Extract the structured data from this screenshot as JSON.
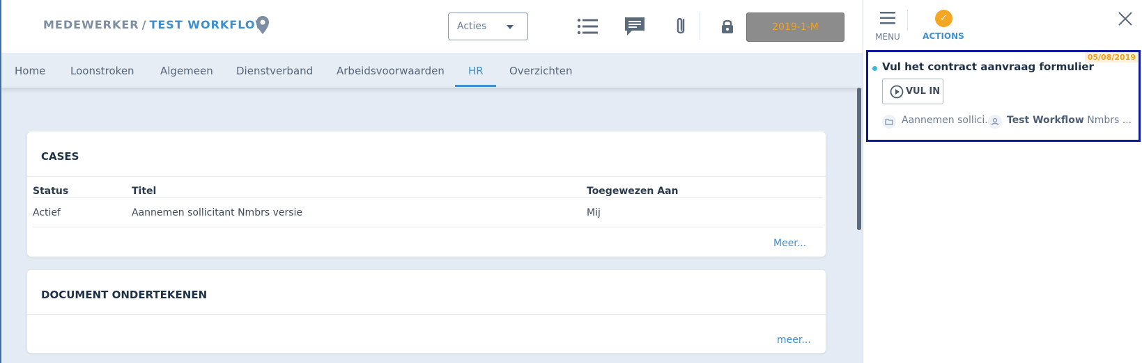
{
  "header": {
    "crumb_parent": "MEDEWERKER",
    "crumb_separator": "/",
    "crumb_current": "TEST WORKFLOW",
    "actions_dropdown": "Acties",
    "period_button": "2019-1-M"
  },
  "tabs": [
    {
      "label": "Home"
    },
    {
      "label": "Loonstroken"
    },
    {
      "label": "Algemeen"
    },
    {
      "label": "Dienstverband"
    },
    {
      "label": "Arbeidsvoorwaarden"
    },
    {
      "label": "HR"
    },
    {
      "label": "Overzichten"
    }
  ],
  "active_tab": "HR",
  "cases": {
    "title": "CASES",
    "columns": [
      "Status",
      "Titel",
      "Toegewezen Aan"
    ],
    "rows": [
      {
        "status": "Actief",
        "titel": "Aannemen sollicitant Nmbrs versie",
        "toegewezen": "Mij"
      }
    ],
    "more_link": "Meer..."
  },
  "document": {
    "title": "DOCUMENT ONDERTEKENEN",
    "more_link": "meer..."
  },
  "panel": {
    "menu_label": "MENU",
    "actions_label": "ACTIONS",
    "action_item": {
      "date": "05/08/2019",
      "title": "Vul het contract aanvraag formulier",
      "button": "VUL IN",
      "case_ref": "Aannemen sollici...",
      "user_bold": "Test Workflow",
      "user_rest": "Nmbrs ..."
    }
  },
  "colors": {
    "accent": "#3d8fd0",
    "warning": "#f5a623",
    "highlight_border": "#0d1a9c"
  }
}
